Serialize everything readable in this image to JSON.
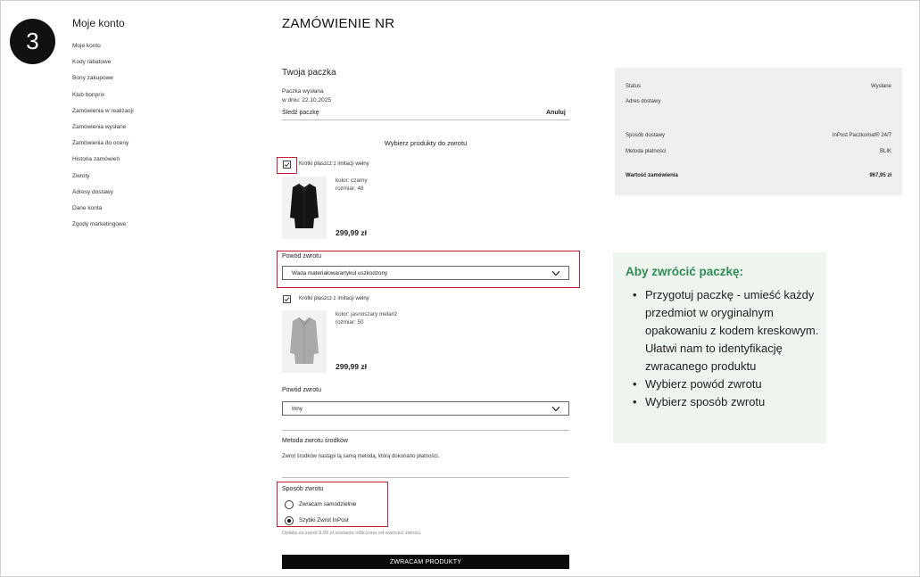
{
  "step": "3",
  "sidebar": {
    "title": "Moje konto",
    "items": [
      {
        "label": "Moje konto"
      },
      {
        "label": "Kody rabatowe"
      },
      {
        "label": "Bony zakupowe"
      },
      {
        "label": "Klub bonprix"
      },
      {
        "label": "Zamówienia w realizacji"
      },
      {
        "label": "Zamówienia wysłane"
      },
      {
        "label": "Zamówienia do oceny"
      },
      {
        "label": "Historia zamówień"
      },
      {
        "label": "Zwroty"
      },
      {
        "label": "Adresy dostawy"
      },
      {
        "label": "Dane konta"
      },
      {
        "label": "Zgody marketingowe"
      }
    ]
  },
  "order": {
    "title": "ZAMÓWIENIE NR",
    "section_title": "Twoja paczka",
    "shipped_label": "Paczka wysłana",
    "shipped_date": "w dniu: 22.10.2025",
    "track_label": "Śledź paczkę",
    "cancel_label": "Anuluj",
    "choose_products": "Wybierz produkty do zwrotu"
  },
  "items": [
    {
      "name": "Krótki płaszcz z imitacji wełny",
      "color": "kolor: czarny",
      "size": "rozmiar: 48",
      "price": "299,99 zł",
      "checked": true,
      "reason_label": "Powód zwrotu",
      "reason_value": "Wada materiałowa/artykuł uszkodzony"
    },
    {
      "name": "Krótki płaszcz z imitacji wełny",
      "color": "kolor: jasnoszary melanż",
      "size": "rozmiar: 50",
      "price": "299,99 zł",
      "checked": true,
      "reason_label": "Powód zwrotu",
      "reason_value": "Inny"
    }
  ],
  "refund": {
    "title": "Metoda zwrotu środków",
    "text": "Zwrot środków nastąpi tą samą metodą, którą dokonano płatności."
  },
  "return_method": {
    "title": "Sposób zwrotu",
    "options": [
      {
        "label": "Zwracam samodzielnie",
        "selected": false
      },
      {
        "label": "Szybki Zwrot InPost",
        "selected": true
      }
    ],
    "fee_note": "Opłata za zwrot 9,99 zł zostanie odliczona od wartości zwrotu."
  },
  "submit_label": "ZWRACAM PRODUKTY",
  "summary": {
    "status_label": "Status",
    "status_value": "Wysłane",
    "address_label": "Adres dostawy",
    "delivery_label": "Sposób dostawy",
    "delivery_value": "InPost Paczkomat® 24/7",
    "payment_label": "Metoda płatności",
    "payment_value": "BLIK",
    "total_label": "Wartość zamówienia",
    "total_value": "967,95 zł"
  },
  "info": {
    "title": "Aby zwrócić paczkę:",
    "items": [
      "Przygotuj paczkę - umieść każdy przedmiot w oryginalnym opakowaniu z kodem kreskowym. Ułatwi nam to identyfikację zwracanego produktu",
      "Wybierz powód zwrotu",
      "Wybierz sposób zwrotu"
    ]
  },
  "colors": {
    "highlight": "#c8202f",
    "info_title": "#2f8a55",
    "info_bg": "#eef5ee",
    "summary_bg": "#efefef"
  }
}
